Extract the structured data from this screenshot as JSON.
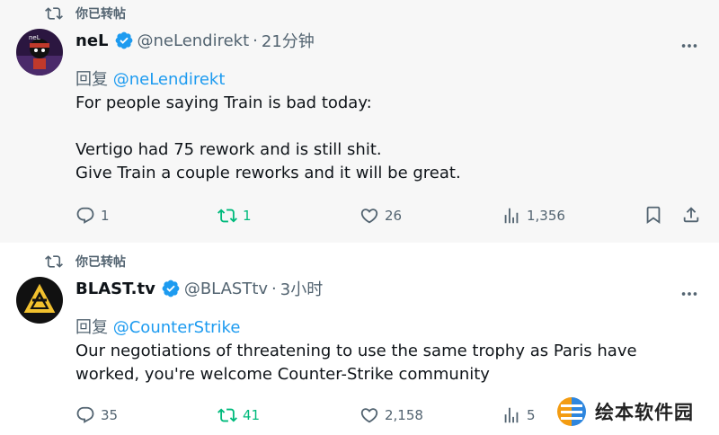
{
  "tweets": [
    {
      "retweet_label": "你已转帖",
      "author_name": "neL",
      "author_handle": "@neLendirekt",
      "separator": "·",
      "time": "21分钟",
      "reply_prefix": "回复",
      "reply_to": "@neLendirekt",
      "text": "For people saying Train is bad today:\n\nVertigo had 75 rework and is still shit.\nGive Train a couple reworks and it will be great.",
      "stats": {
        "replies": "1",
        "retweets": "1",
        "likes": "26",
        "views": "1,356"
      }
    },
    {
      "retweet_label": "你已转帖",
      "author_name": "BLAST.tv",
      "author_handle": "@BLASTtv",
      "separator": "·",
      "time": "3小时",
      "reply_prefix": "回复",
      "reply_to": "@CounterStrike",
      "text": "Our negotiations of threatening to use the same trophy as Paris have worked, you're welcome Counter-Strike community",
      "stats": {
        "replies": "35",
        "retweets": "41",
        "likes": "2,158",
        "views": "5"
      }
    }
  ],
  "watermark": {
    "text": "绘本软件园"
  },
  "colors": {
    "accent": "#1d9bf0",
    "retweet_active": "#00ba7c",
    "muted": "#536471",
    "text": "#0f1419"
  },
  "icons": [
    "retweet-icon",
    "verified-badge-icon",
    "more-icon",
    "reply-icon",
    "like-icon",
    "views-icon",
    "bookmark-icon",
    "share-icon"
  ]
}
